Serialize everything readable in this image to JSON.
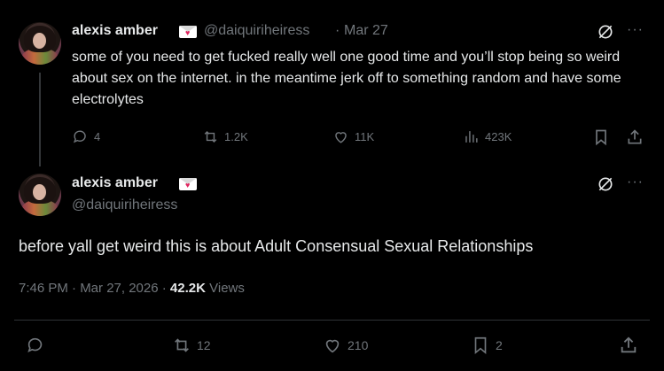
{
  "tweet1": {
    "name": "alexis amber",
    "handle": "@daiquiriheiress",
    "dot": "·",
    "date": "Mar 27",
    "text": "some of you need to get fucked really well one good time and you’ll stop being so weird about sex on the internet. in the meantime jerk off to something random and have some electrolytes",
    "replies": "4",
    "reposts": "1.2K",
    "likes": "11K",
    "views": "423K",
    "more": "···"
  },
  "tweet2": {
    "name": "alexis amber",
    "handle": "@daiquiriheiress",
    "text": "before yall get weird this is about Adult Consensual Sexual Relationships",
    "time": "7:46 PM · Mar 27, 2026 · ",
    "view_count": "42.2K",
    "views_label": "Views",
    "reposts": "12",
    "likes": "210",
    "bookmarks": "2",
    "more": "···"
  },
  "colors": {
    "background": "#000000",
    "text": "#e7e9ea",
    "muted": "#71767b",
    "divider": "#2f3336",
    "badge_heart": "#e0245e"
  },
  "icons": [
    "avatar",
    "envelope-heart-badge",
    "grok-icon",
    "more-icon",
    "reply-icon",
    "repost-icon",
    "like-icon",
    "views-icon",
    "bookmark-icon",
    "share-icon"
  ]
}
